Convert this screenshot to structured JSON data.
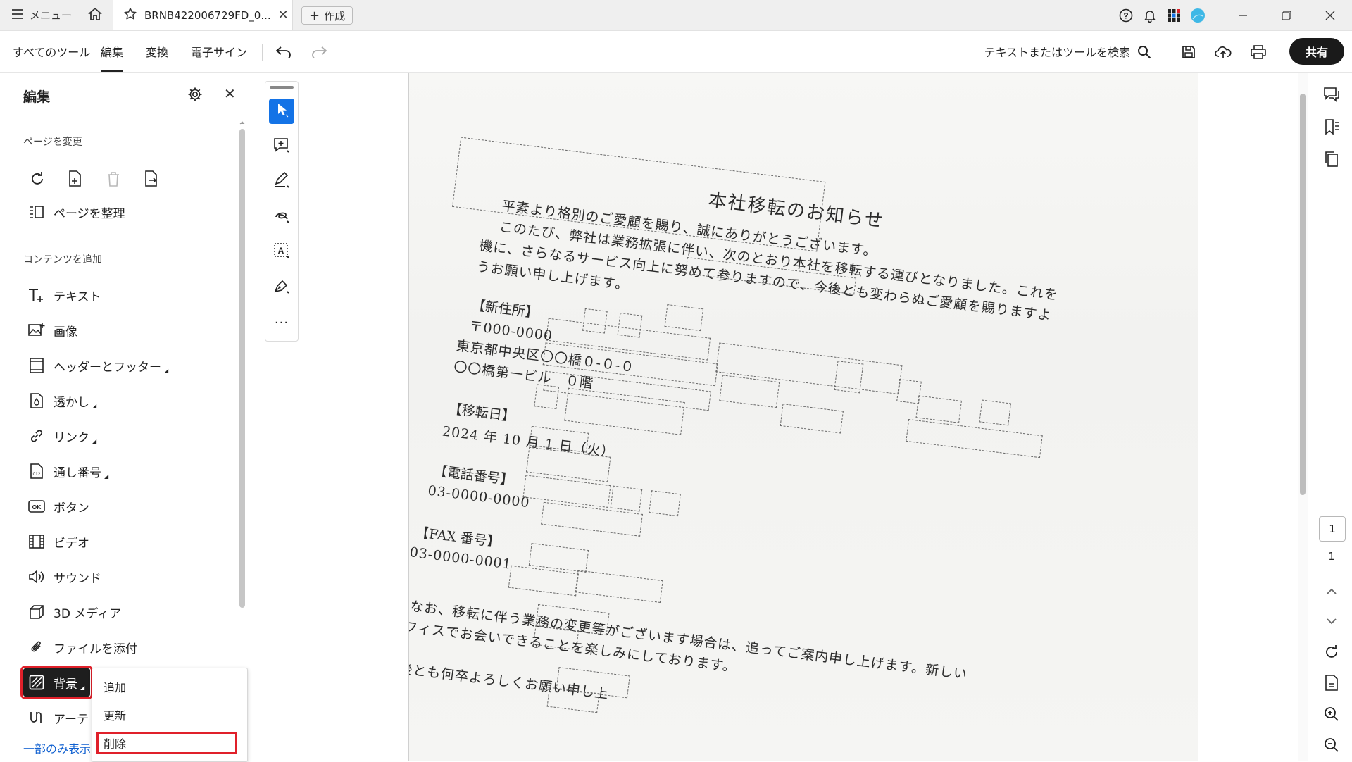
{
  "titlebar": {
    "menu_label": "メニュー",
    "tab_title": "BRNB422006729FD_0...",
    "create_label": "作成",
    "icons": [
      "help-icon",
      "bell-icon",
      "apps-icon",
      "profile-icon"
    ]
  },
  "toolbar": {
    "tabs": [
      "すべてのツール",
      "編集",
      "変換",
      "電子サイン"
    ],
    "active_tab": "編集",
    "search_label": "テキストまたはツールを検索",
    "share_label": "共有"
  },
  "panel": {
    "title": "編集",
    "section_page": "ページを変更",
    "organize_label": "ページを整理",
    "section_content": "コンテンツを追加",
    "items": [
      {
        "label": "テキスト",
        "icon": "text-add-icon"
      },
      {
        "label": "画像",
        "icon": "image-icon"
      },
      {
        "label": "ヘッダーとフッター",
        "icon": "header-footer-icon"
      },
      {
        "label": "透かし",
        "icon": "watermark-icon"
      },
      {
        "label": "リンク",
        "icon": "link-icon"
      },
      {
        "label": "通し番号",
        "icon": "bates-number-icon"
      },
      {
        "label": "ボタン",
        "icon": "button-icon"
      },
      {
        "label": "ビデオ",
        "icon": "video-icon"
      },
      {
        "label": "サウンド",
        "icon": "sound-icon"
      },
      {
        "label": "3D メディア",
        "icon": "3d-media-icon"
      },
      {
        "label": "ファイルを添付",
        "icon": "attach-icon"
      },
      {
        "label": "背景",
        "icon": "background-icon"
      },
      {
        "label": "アーテ",
        "icon": "artifact-icon"
      }
    ],
    "show_less": "一部のみ表示"
  },
  "dropdown": {
    "items": [
      "追加",
      "更新",
      "削除"
    ]
  },
  "document": {
    "title": "本社移転のお知らせ",
    "para1": [
      "平素より格別のご愛顧を賜り、誠にありがとうございます。",
      "このたび、弊社は業務拡張に伴い、次のとおり本社を移転する運びとなりました。これを",
      "機に、さらなるサービス向上に努めて参りますので、今後とも変わらぬご愛顧を賜りますよ",
      "うお願い申し上げます。"
    ],
    "address_head": "【新住所】",
    "postal": "〒000-0000",
    "address1": "東京都中央区〇〇橋０-０-０",
    "address2": "〇〇橋第一ビル　０階",
    "date_head": "【移転日】",
    "date": "2024 年 10 月 1 日（火）",
    "tel_head": "【電話番号】",
    "tel": "03-0000-0000",
    "fax_head": "【FAX 番号】",
    "fax": "03-0000-0001",
    "para2": [
      "なお、移転に伴う業務の変更等がございます場合は、追ってご案内申し上げます。新しい",
      "オフィスでお会いできることを楽しみにしております。"
    ],
    "para3": "今後とも何卒よろしくお願い申し上"
  },
  "pager": {
    "current": "1",
    "total": "1"
  },
  "colors": {
    "accent": "#1473e6",
    "highlight": "#e0202a",
    "selected_bg": "#1e1e1e"
  }
}
